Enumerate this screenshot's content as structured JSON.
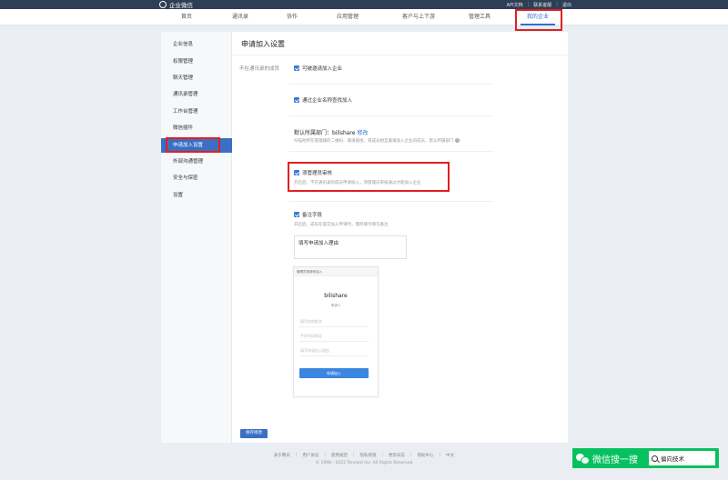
{
  "header": {
    "logo_text": "企业微信",
    "top_links": [
      "API文档",
      "联系客服",
      "退出"
    ]
  },
  "nav": {
    "items": [
      "首页",
      "通讯录",
      "协作",
      "应用管理",
      "客户与上下游",
      "管理工具",
      "我的企业"
    ],
    "active_index": 6
  },
  "sidebar": {
    "items": [
      "企业信息",
      "权限管理",
      "聊天管理",
      "通讯录管理",
      "工作台管理",
      "微信插件",
      "申请加入设置",
      "外部沟通管理",
      "安全与保密",
      "设置"
    ],
    "active_index": 6
  },
  "main": {
    "title": "申请加入设置",
    "left_label": "不在通讯录的成员",
    "options": {
      "opt1_label": "可被邀请加入企业",
      "opt2_label": "通过企业名称查找加入",
      "dept_label": "默认所属部门：",
      "dept_value": "bilishare",
      "dept_edit": "修改",
      "dept_desc": "扫描他所在管理端的二维码、邀请链接、或成员相互邀请加入企业的成员，默认所属部门",
      "help_icon": "?",
      "admin_label": "须管理员审核",
      "admin_desc": "开启后，不在通讯录的成员申请加入，须管理员审核通过才能加入企业",
      "remark_label": "备注字段",
      "remark_desc": "开启后，成员在提交加入申请时，需所填示填写备注",
      "remark_value": "填写申请加入理由"
    },
    "preview": {
      "header": "管理员邀请你加入",
      "corp_name": "bilishare",
      "sub": "申请人",
      "fields": [
        "填写你的姓名",
        "手机号码验证",
        "填写申请加入理由"
      ],
      "button": "申请加入"
    },
    "save_button": "保存修改"
  },
  "footer": {
    "links": [
      "关于腾讯",
      "用户协议",
      "使用规范",
      "隐私政策",
      "更新日志",
      "帮助中心",
      "中文"
    ],
    "copyright": "© 1998 - 2022 Tencent Inc. All Rights Reserved"
  },
  "watermark": {
    "text": "微信搜一搜",
    "query": "偏向技术"
  }
}
